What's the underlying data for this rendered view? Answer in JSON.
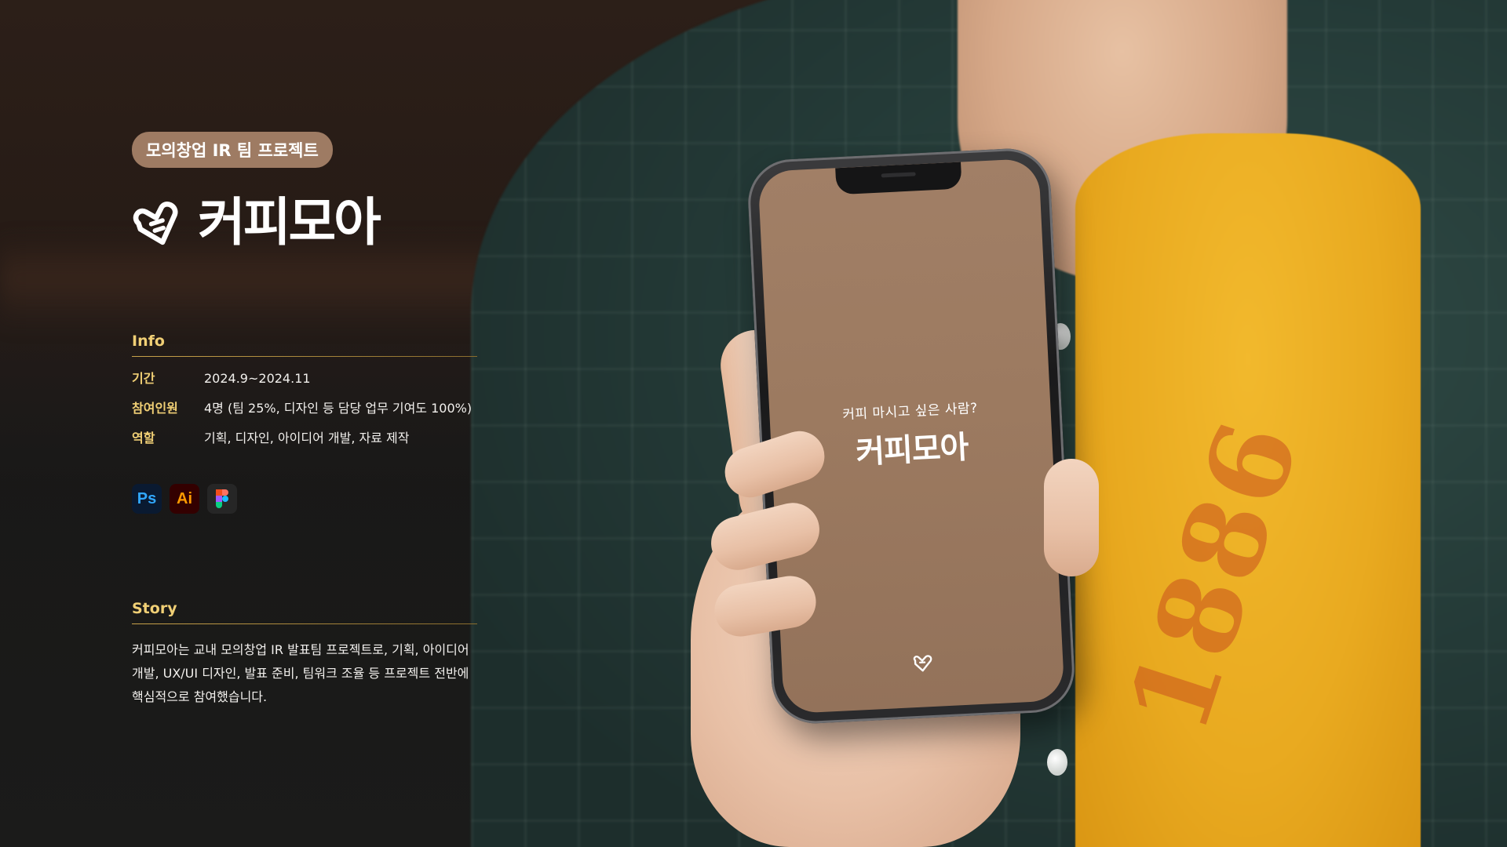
{
  "badge": "모의창업 IR 팀 프로젝트",
  "brand": {
    "name": "커피모아"
  },
  "info": {
    "title": "Info",
    "rows": [
      {
        "label": "기간",
        "value": "2024.9~2024.11"
      },
      {
        "label": "참여인원",
        "value": "4명 (팀 25%, 디자인 등 담당 업무 기여도 100%)"
      },
      {
        "label": "역할",
        "value": "기획, 디자인, 아이디어 개발, 자료 제작"
      }
    ]
  },
  "tools": [
    {
      "name": "Ps",
      "icon": "photoshop-icon",
      "color": "#31a8ff"
    },
    {
      "name": "Ai",
      "icon": "illustrator-icon",
      "color": "#ff9a00"
    },
    {
      "name": "",
      "icon": "figma-icon"
    }
  ],
  "story": {
    "title": "Story",
    "text": "커피모아는 교내 모의창업 IR 발표팀 프로젝트로, 기획, 아이디어 개발, UX/UI 디자인, 발표 준비, 팀워크 조율 등 프로젝트 전반에 핵심적으로 참여했습니다."
  },
  "phone": {
    "tagline": "커피 마시고 싶은 사람?",
    "logo": "커피모아"
  },
  "colors": {
    "accent": "#f0cf75",
    "badge_bg": "#9e7b63",
    "screen_bg": "#9c7a60"
  }
}
